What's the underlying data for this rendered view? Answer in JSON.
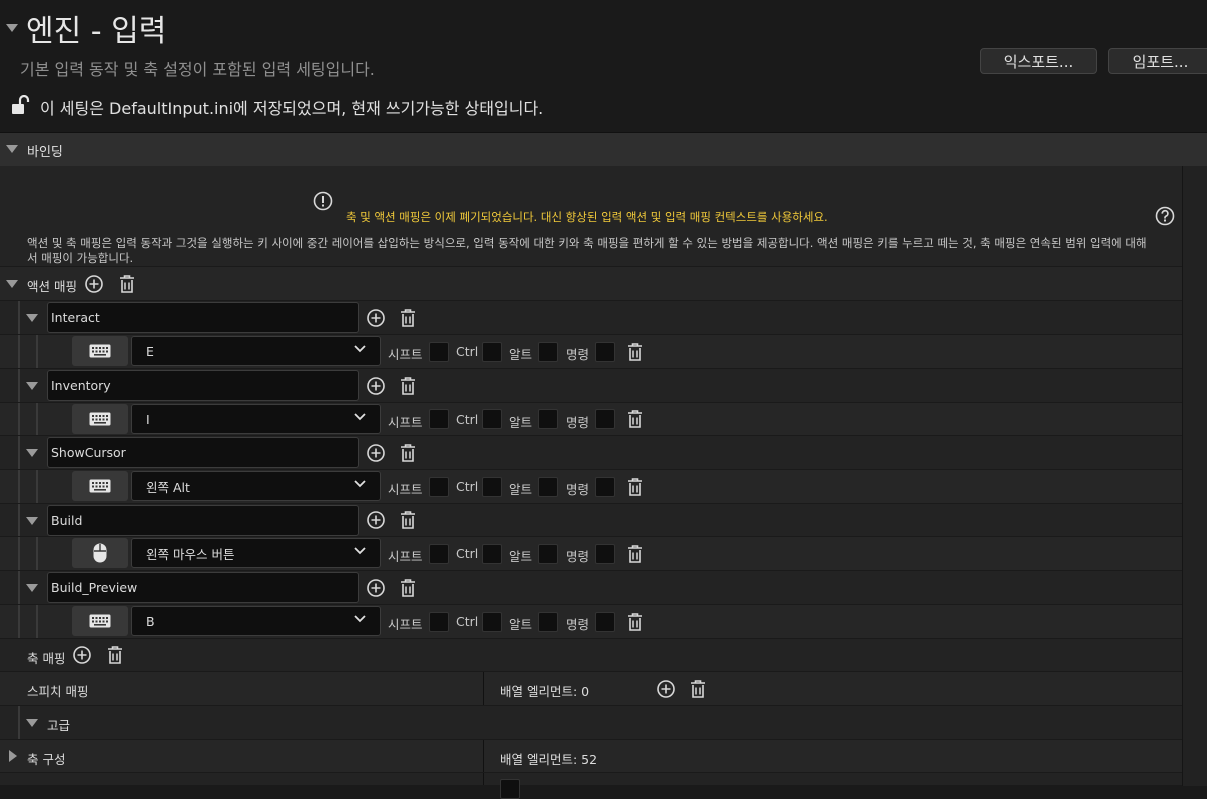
{
  "header": {
    "title": "엔진 - 입력",
    "subtitle": "기본 입력 동작 및 축 설정이 포함된 입력 세팅입니다.",
    "export_label": "익스포트...",
    "import_label": "임포트...",
    "save_note": "이 세팅은 DefaultInput.ini에 저장되었으며, 현재 쓰기가능한 상태입니다."
  },
  "bindings": {
    "category_label": "바인딩",
    "warning": "축 및 액션 매핑은 이제 폐기되었습니다. 대신 향상된 입력 액션 및 입력 매핑 컨텍스트를 사용하세요.",
    "description": "액션 및 축 매핑은 입력 동작과 그것을 실행하는 키 사이에 중간 레이어를 삽입하는 방식으로, 입력 동작에 대한 키와 축 매핑을 편하게 할 수 있는 방법을 제공합니다. 액션 매핑은 키를 누르고 떼는 것, 축 매핑은 연속된 범위 입력에 대해서 매핑이 가능합니다.",
    "action_mappings_label": "액션 매핑",
    "modifiers": {
      "shift": "시프트",
      "ctrl": "Ctrl",
      "alt": "알트",
      "cmd": "명령"
    },
    "actions": [
      {
        "name": "Interact",
        "key": "E",
        "device": "keyboard-icon"
      },
      {
        "name": "Inventory",
        "key": "I",
        "device": "keyboard-icon"
      },
      {
        "name": "ShowCursor",
        "key": "왼쪽 Alt",
        "device": "keyboard-icon"
      },
      {
        "name": "Build",
        "key": "왼쪽 마우스 버튼",
        "device": "mouse-icon"
      },
      {
        "name": "Build_Preview",
        "key": "B",
        "device": "keyboard-icon"
      }
    ],
    "axis_mappings_label": "축 매핑",
    "speech_mappings_label": "스피치 매핑",
    "speech_array": "배열 엘리먼트: 0",
    "advanced_label": "고급",
    "axis_config_label": "축 구성",
    "axis_config_array": "배열 엘리먼트: 52"
  }
}
